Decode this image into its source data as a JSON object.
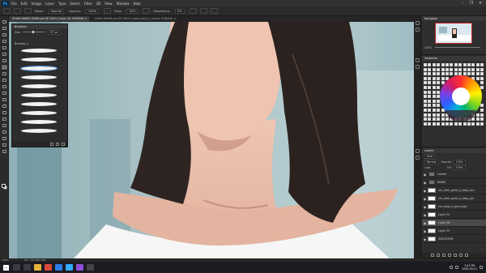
{
  "app": {
    "logo": "Ps"
  },
  "menu": [
    "File",
    "Edit",
    "Image",
    "Layer",
    "Type",
    "Select",
    "Filter",
    "3D",
    "View",
    "Window",
    "Help"
  ],
  "window_controls": {
    "minimize": "–",
    "maximize": "❐",
    "close": "✕"
  },
  "options": {
    "mode_label": "Mode:",
    "mode_value": "Normal",
    "opacity_label": "Opacity:",
    "opacity_value": "100%",
    "flow_label": "Flow:",
    "flow_value": "32%",
    "smoothing_label": "Smoothing:",
    "smoothing_value": "0%"
  },
  "tabs": [
    {
      "label": "ZHAIN INAIPA 3DWN.psd @ 100% (Layer 28, RGB/8#) ×",
      "active": true
    },
    {
      "label": "ZHAIN INAIPA.psd @ 100% (nadia_body_b_naked, RGB/8#) ×",
      "active": false
    }
  ],
  "brush_panel": {
    "title": "Brushes",
    "size_label": "Size",
    "size_value": "97 px",
    "folder": "Brushes_1",
    "brush_count": 10,
    "selected_index": 2
  },
  "navigator": {
    "title": "Navigator",
    "zoom": "100%"
  },
  "swatches": {
    "title": "Swatches"
  },
  "layers": {
    "title": "Layers",
    "kind_label": "Kind",
    "blend_mode": "Normal",
    "opacity_label": "Opacity:",
    "opacity_value": "100%",
    "lock_label": "Lock:",
    "fill_label": "Fill:",
    "fill_value": "100%",
    "items": [
      {
        "name": "Lineart",
        "type": "folder",
        "visible": true,
        "selected": false
      },
      {
        "name": "NADIA",
        "type": "folder",
        "visible": true,
        "selected": false
      },
      {
        "name": "nm_brmt_grass_a_baby_bra",
        "type": "layer",
        "visible": true,
        "selected": false
      },
      {
        "name": "nm_brmt_grass_a_baby_girl",
        "type": "layer",
        "visible": true,
        "selected": false
      },
      {
        "name": "nm_body_b_genn_bad",
        "type": "layer",
        "visible": true,
        "selected": false
      },
      {
        "name": "Layer 24",
        "type": "layer",
        "visible": true,
        "selected": false
      },
      {
        "name": "Layer 28",
        "type": "layer",
        "visible": true,
        "selected": true
      },
      {
        "name": "Layer 25",
        "type": "layer",
        "visible": true,
        "selected": false
      },
      {
        "name": "SICK ROOM",
        "type": "layer",
        "visible": true,
        "selected": false
      }
    ]
  },
  "status": {
    "zoom": "100%",
    "doc": "Doc: 34.3M/2.66G"
  },
  "taskbar": {
    "time": "3:41 PM",
    "date": "2020-04-11"
  },
  "colors": {
    "hair": "#2e2522",
    "skin": "#ecc0ab",
    "skin_shadow": "#c99784",
    "shirt": "#f6f6f6",
    "background": "#a9c3c7",
    "selection": "#4b4b4b"
  }
}
